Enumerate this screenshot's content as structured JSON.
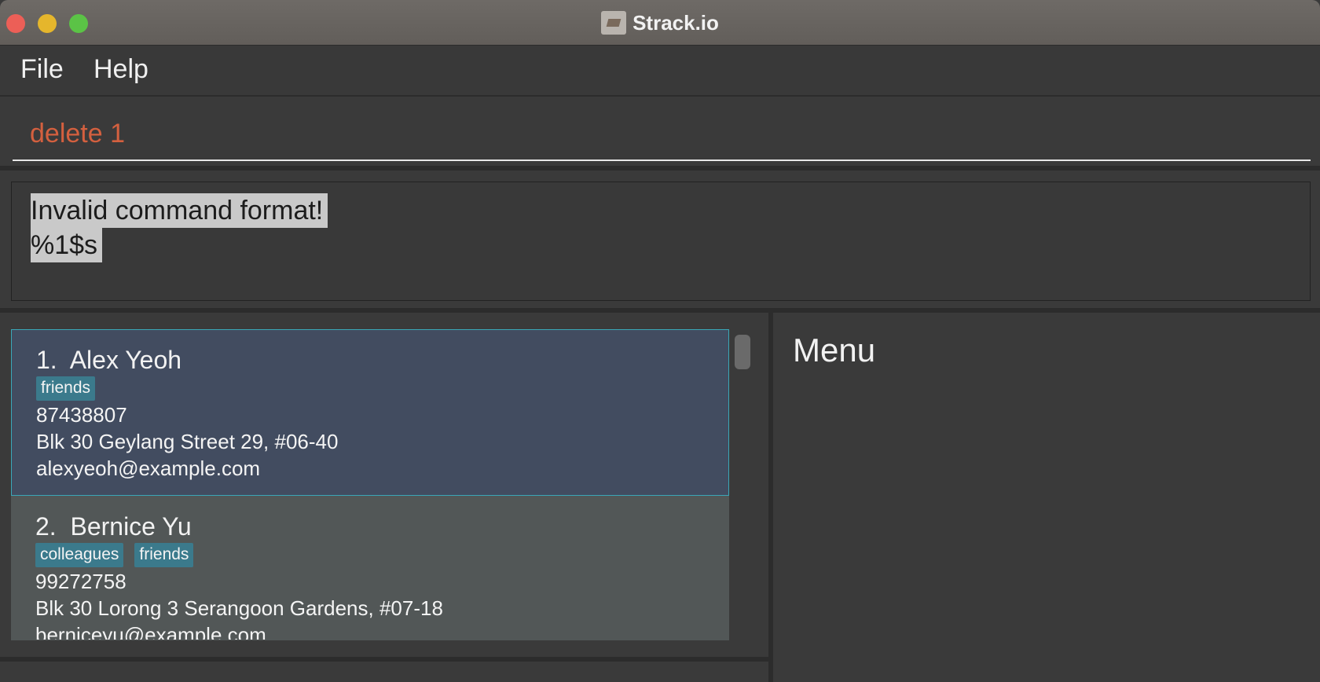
{
  "window": {
    "title": "Strack.io"
  },
  "menubar": {
    "file": "File",
    "help": "Help"
  },
  "command": {
    "value": "delete 1"
  },
  "result": {
    "line1": "Invalid command format!",
    "line2": "%1$s"
  },
  "persons": [
    {
      "index": "1.",
      "name": "Alex Yeoh",
      "tags": [
        "friends"
      ],
      "phone": "87438807",
      "address": "Blk 30 Geylang Street 29, #06-40",
      "email": "alexyeoh@example.com"
    },
    {
      "index": "2.",
      "name": "Bernice Yu",
      "tags": [
        "colleagues",
        "friends"
      ],
      "phone": "99272758",
      "address": "Blk 30 Lorong 3 Serangoon Gardens, #07-18",
      "email": "berniceyu@example.com"
    }
  ],
  "side_panel": {
    "title": "Menu"
  },
  "colors": {
    "background": "#3a3a3a",
    "command_text": "#d4603f",
    "selected_card": "#424c60",
    "card": "#525757",
    "tag": "#3b7a8c",
    "selection_border": "#3aa7b8"
  }
}
